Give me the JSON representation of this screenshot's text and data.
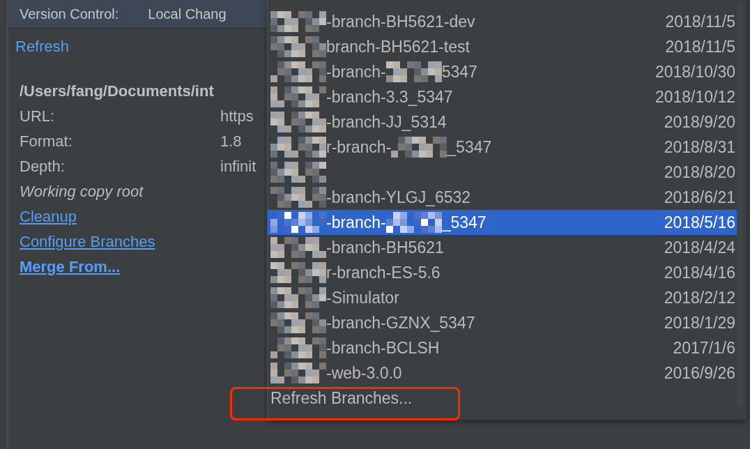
{
  "tool_window": {
    "tabs": [
      {
        "label": "Version Control:",
        "kind": "title"
      },
      {
        "label": "Local Chang",
        "kind": "tab"
      }
    ]
  },
  "info_panel": {
    "refresh_link": "Refresh",
    "path": "/Users/fang/Documents/int",
    "properties": [
      {
        "label": "URL:",
        "value": "https"
      },
      {
        "label": "Format:",
        "value": "1.8"
      },
      {
        "label": "Depth:",
        "value": "infinit"
      }
    ],
    "note": "Working copy root",
    "actions": [
      {
        "label": "Cleanup",
        "kind": "link"
      },
      {
        "label": "Configure Branches",
        "kind": "link"
      },
      {
        "label": "Merge From...",
        "kind": "strong-link"
      }
    ]
  },
  "branch_popup": {
    "branches": [
      {
        "segments": [
          {
            "kind": "mosaic"
          },
          {
            "kind": "text",
            "text": "-branch-BH5621-dev"
          }
        ],
        "date": "2018/11/5",
        "selected": false
      },
      {
        "segments": [
          {
            "kind": "mosaic"
          },
          {
            "kind": "text",
            "text": "branch-BH5621-test"
          }
        ],
        "date": "2018/11/5",
        "selected": false
      },
      {
        "segments": [
          {
            "kind": "mosaic"
          },
          {
            "kind": "text",
            "text": "-branch-"
          },
          {
            "kind": "mosaic"
          },
          {
            "kind": "text",
            "text": "5347"
          }
        ],
        "date": "2018/10/30",
        "selected": false
      },
      {
        "segments": [
          {
            "kind": "mosaic"
          },
          {
            "kind": "text",
            "text": "-branch-3.3_5347"
          }
        ],
        "date": "2018/10/12",
        "selected": false
      },
      {
        "segments": [
          {
            "kind": "mosaic"
          },
          {
            "kind": "text",
            "text": "-branch-JJ_5314"
          }
        ],
        "date": "2018/9/20",
        "selected": false
      },
      {
        "segments": [
          {
            "kind": "mosaic"
          },
          {
            "kind": "text",
            "text": "r-branch-"
          },
          {
            "kind": "mosaic"
          },
          {
            "kind": "text",
            "text": "_5347"
          }
        ],
        "date": "2018/8/31",
        "selected": false
      },
      {
        "segments": [
          {
            "kind": "mosaic"
          }
        ],
        "date": "2018/8/20",
        "selected": false
      },
      {
        "segments": [
          {
            "kind": "mosaic"
          },
          {
            "kind": "text",
            "text": "-branch-YLGJ_6532"
          }
        ],
        "date": "2018/6/21",
        "selected": false
      },
      {
        "segments": [
          {
            "kind": "mosaic"
          },
          {
            "kind": "text",
            "text": "-branch-"
          },
          {
            "kind": "mosaic"
          },
          {
            "kind": "text",
            "text": "_5347"
          }
        ],
        "date": "2018/5/16",
        "selected": true
      },
      {
        "segments": [
          {
            "kind": "mosaic"
          },
          {
            "kind": "text",
            "text": "-branch-BH5621"
          }
        ],
        "date": "2018/4/24",
        "selected": false
      },
      {
        "segments": [
          {
            "kind": "mosaic"
          },
          {
            "kind": "text",
            "text": "r-branch-ES-5.6"
          }
        ],
        "date": "2018/4/16",
        "selected": false
      },
      {
        "segments": [
          {
            "kind": "mosaic"
          },
          {
            "kind": "text",
            "text": "-Simulator"
          }
        ],
        "date": "2018/2/12",
        "selected": false
      },
      {
        "segments": [
          {
            "kind": "mosaic"
          },
          {
            "kind": "text",
            "text": "-branch-GZNX_5347"
          }
        ],
        "date": "2018/1/29",
        "selected": false
      },
      {
        "segments": [
          {
            "kind": "mosaic"
          },
          {
            "kind": "text",
            "text": "-branch-BCLSH"
          }
        ],
        "date": "2017/1/6",
        "selected": false
      },
      {
        "segments": [
          {
            "kind": "mosaic"
          },
          {
            "kind": "text",
            "text": "-web-3.0.0"
          }
        ],
        "date": "2016/9/26",
        "selected": false
      }
    ],
    "footer_action": "Refresh Branches...",
    "highlighted": true
  }
}
